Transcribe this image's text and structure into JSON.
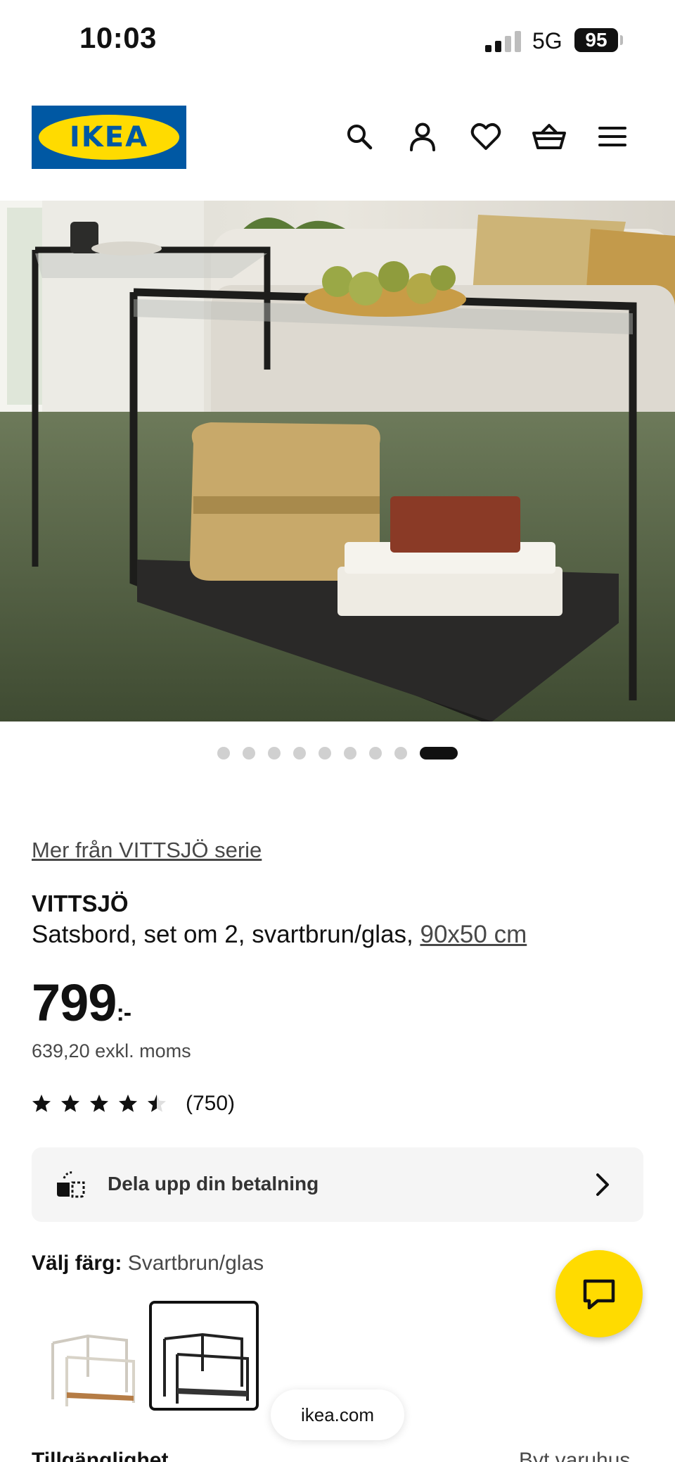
{
  "status_bar": {
    "time": "10:03",
    "network": "5G",
    "battery": "95"
  },
  "header": {
    "logo_text": "IKEA",
    "icons": [
      "search-icon",
      "account-icon",
      "heart-icon",
      "basket-icon",
      "menu-icon"
    ]
  },
  "carousel": {
    "total": 9,
    "active_index": 8
  },
  "product": {
    "series_link": "Mer från VITTSJÖ serie",
    "name": "VITTSJÖ",
    "description": "Satsbord, set om 2, svartbrun/glas, ",
    "size": "90x50 cm",
    "price": "799",
    "price_suffix": ":-",
    "price_ex_vat": "639,20 exkl. moms",
    "rating": {
      "stars": 4.5,
      "count": "(750)"
    }
  },
  "payment": {
    "label": "Dela upp din betalning"
  },
  "color_picker": {
    "label": "Välj färg:",
    "selected": "Svartbrun/glas",
    "options": [
      "Vit/glas",
      "Svartbrun/glas"
    ],
    "selected_index": 1
  },
  "browser": {
    "url": "ikea.com"
  },
  "footer": {
    "availability": "Tillgänglighet",
    "store": "Byt varuhus"
  },
  "colors": {
    "ikea_blue": "#0058a3",
    "ikea_yellow": "#ffdb00"
  }
}
